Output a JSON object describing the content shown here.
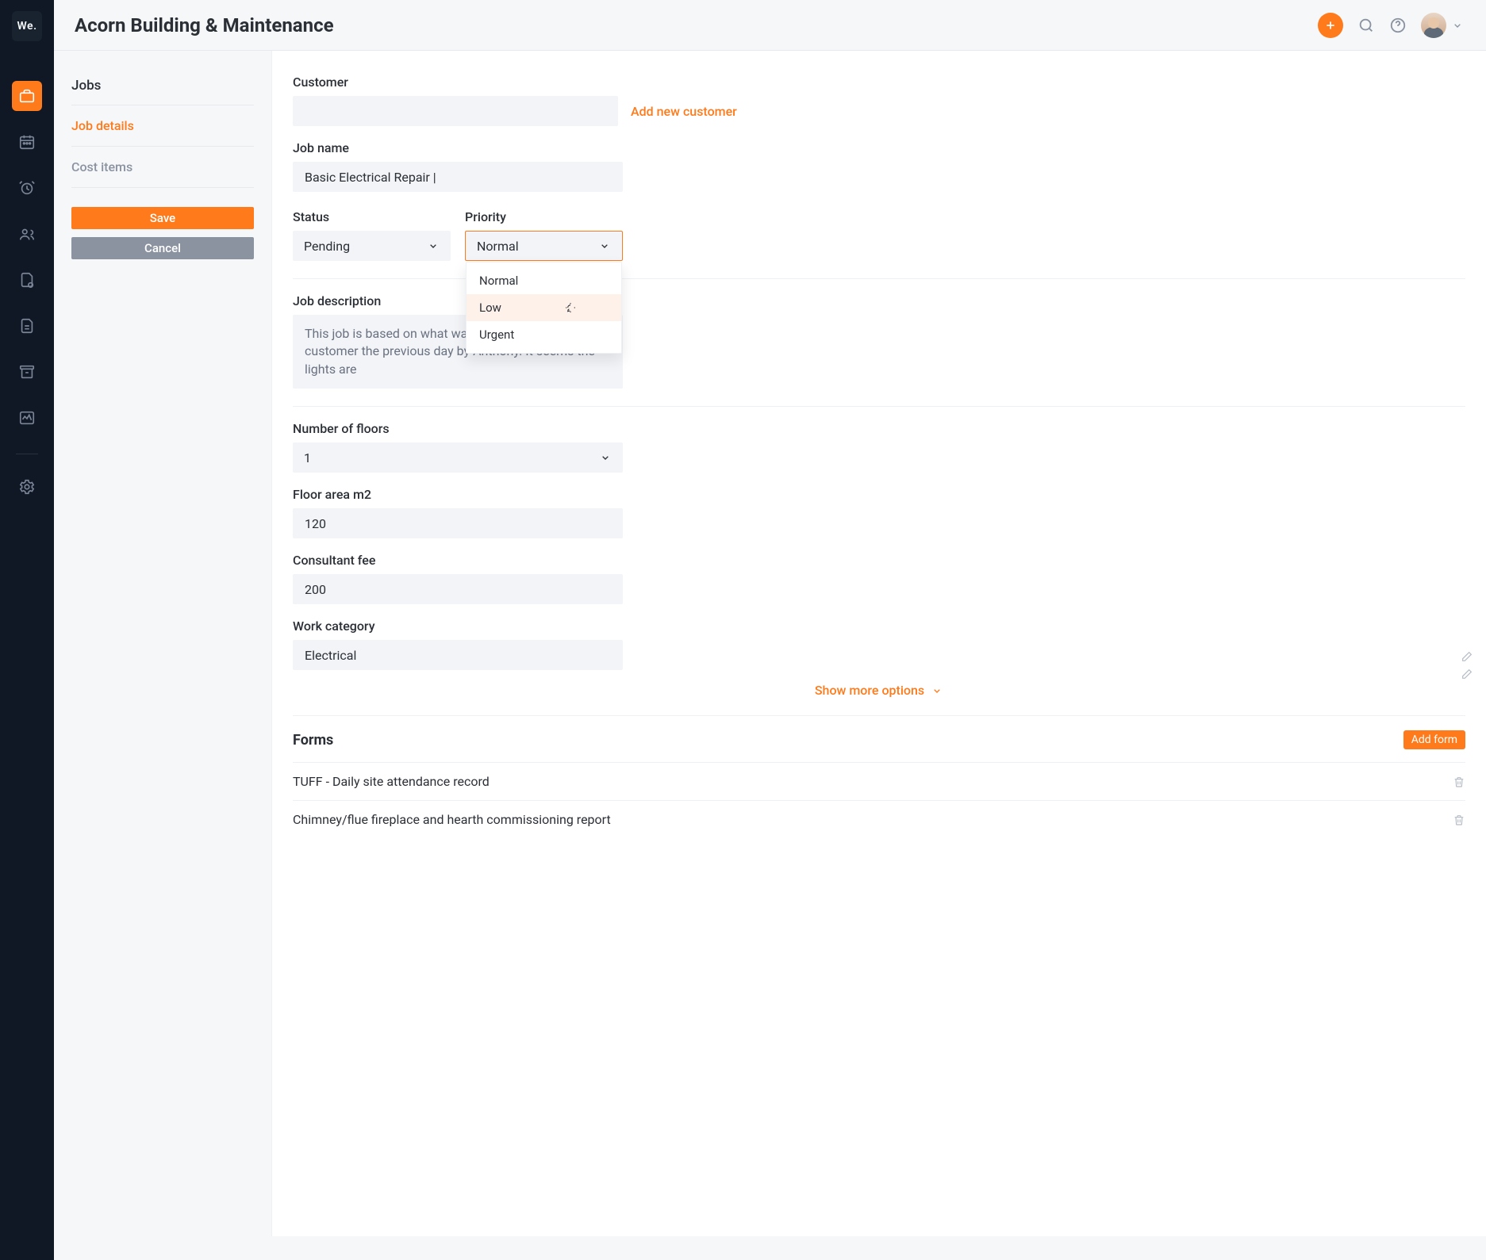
{
  "brand": {
    "short": "We."
  },
  "header": {
    "title": "Acorn Building & Maintenance"
  },
  "sidebar": {
    "section_title": "Jobs",
    "sub_job_details": "Job details",
    "sub_cost_items": "Cost items",
    "save_label": "Save",
    "cancel_label": "Cancel"
  },
  "customer_section": {
    "label": "Customer",
    "input_value": "",
    "add_link": "Add new customer"
  },
  "jobname_section": {
    "label": "Job name",
    "value": "Basic Electrical Repair |"
  },
  "status_section": {
    "label": "Status",
    "value": "Pending"
  },
  "priority_section": {
    "label": "Priority",
    "value": "Normal",
    "options": [
      "Normal",
      "Low",
      "Urgent"
    ],
    "highlight_index": 1
  },
  "description_section": {
    "label": "Job description",
    "text": "This job is based on what was described by the customer the previous day by Anthony. It seems the lights are "
  },
  "floors_section": {
    "label": "Number of floors",
    "value": "1"
  },
  "floorarea_section": {
    "label": "Floor area m2",
    "value": "120"
  },
  "consultantfee_section": {
    "label": "Consultant fee",
    "value": "200"
  },
  "workcategory_section": {
    "label": "Work category",
    "value": "Electrical"
  },
  "show_more_label": "Show more options",
  "forms_section": {
    "title": "Forms",
    "add_label": "Add form",
    "items": [
      "TUFF - Daily site attendance record",
      "Chimney/flue fireplace and hearth commissioning report"
    ]
  },
  "icons": {
    "briefcase": "briefcase",
    "calendar": "calendar",
    "alarm": "alarm",
    "people": "people",
    "doc_status": "doc-status",
    "doc": "doc",
    "archive": "archive",
    "activity": "activity",
    "gear": "gear",
    "plus": "plus",
    "search": "search",
    "help": "help",
    "caret": "caret",
    "chevron_down": "chevron-down",
    "pencil": "pencil",
    "trash": "trash",
    "cursor": "cursor"
  }
}
